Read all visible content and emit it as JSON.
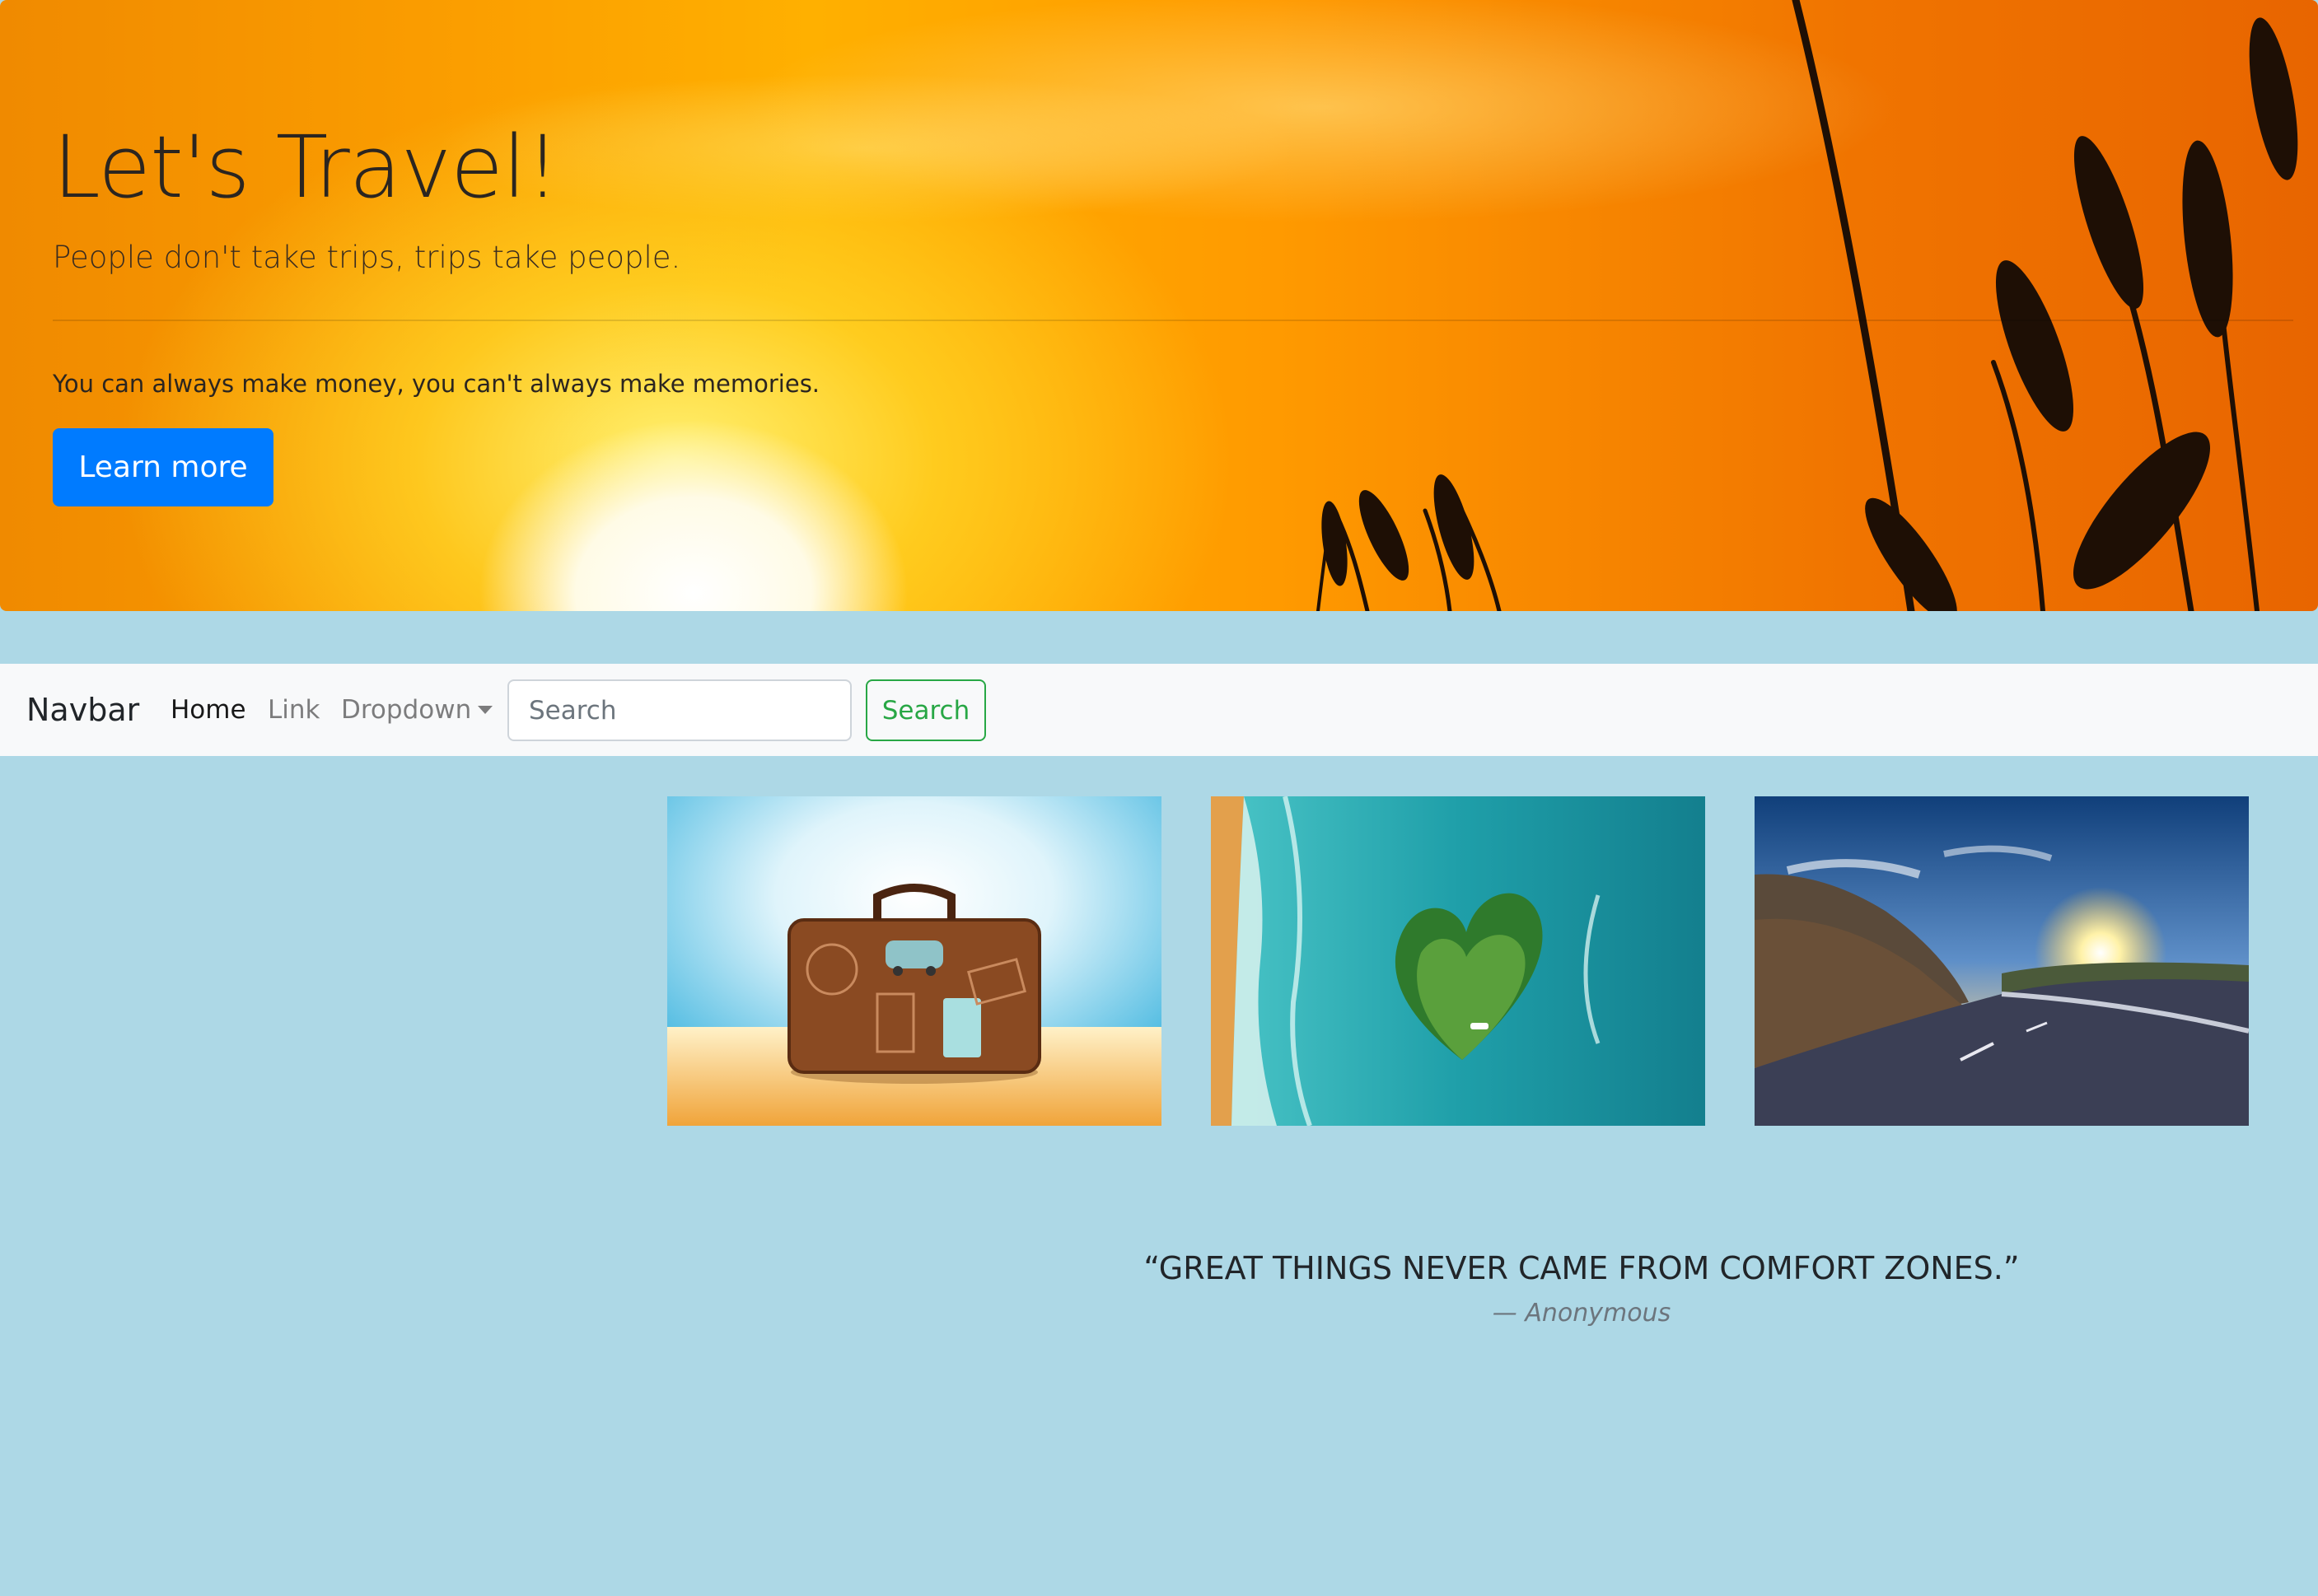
{
  "jumbotron": {
    "title": "Let's Travel!",
    "lead": "People don't take trips, trips take people.",
    "text": "You can always make money, you can't always make memories.",
    "button_label": "Learn more"
  },
  "navbar": {
    "brand": "Navbar",
    "links": [
      {
        "label": "Home",
        "active": true
      },
      {
        "label": "Link",
        "active": false
      },
      {
        "label": "Dropdown",
        "active": false
      }
    ],
    "search": {
      "placeholder": "Search",
      "value": "",
      "button_label": "Search"
    }
  },
  "gallery": [
    {
      "subject": "suitcase on beach"
    },
    {
      "subject": "heart-shaped island"
    },
    {
      "subject": "road at sunset"
    }
  ],
  "quote": {
    "text": "“GREAT THINGS NEVER CAME FROM COMFORT ZONES.”",
    "author": "— Anonymous"
  },
  "colors": {
    "page_background": "#add8e6",
    "primary": "#007bff",
    "success": "#28a745",
    "navbar_background": "#f8f9fa"
  }
}
